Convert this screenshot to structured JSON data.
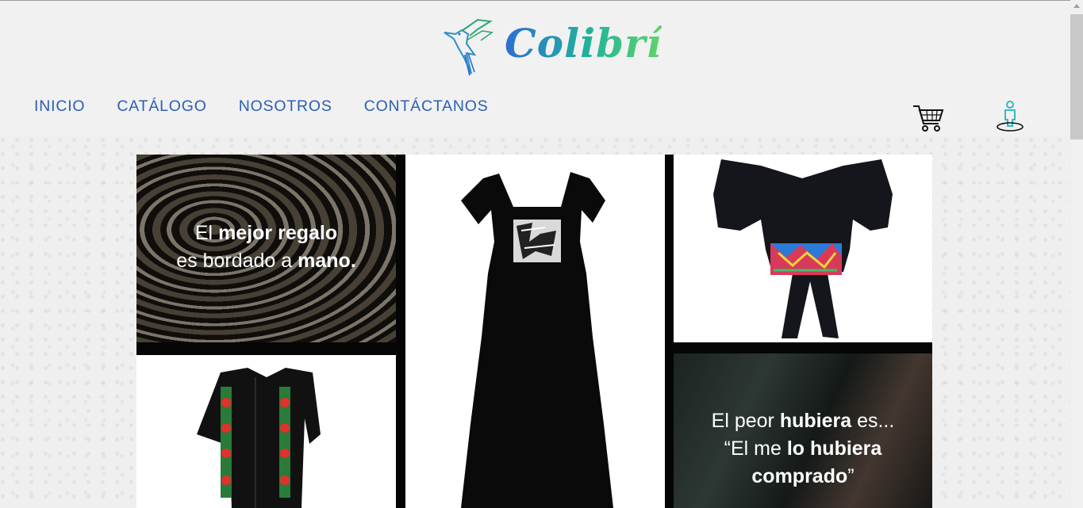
{
  "brand": {
    "name": "Colibrí",
    "logo_icon": "hummingbird-icon",
    "colors": [
      "#2a6fd1",
      "#22b39a",
      "#5fd36b"
    ]
  },
  "nav": {
    "items": [
      "INICIO",
      "CATÁLOGO",
      "NOSOTROS",
      "CONTÁCTANOS"
    ],
    "color": "#2a5fb5"
  },
  "header_icons": {
    "cart": "cart-icon",
    "user": "user-icon"
  },
  "tiles": {
    "embroidery": {
      "line1_plain": "El ",
      "line1_bold": "mejor regalo",
      "line2_plain": "es bordado a ",
      "line2_bold": "mano."
    },
    "dress": {
      "image": "black-embroidered-dress"
    },
    "blouse": {
      "image": "black-off-shoulder-blouse"
    },
    "shirt": {
      "image": "black-guayabera-rose-embroidery"
    },
    "quote": {
      "line1_plain": "El peor ",
      "line1_bold": "hubiera",
      "line1_plain2": " es...",
      "line2_plain": "“El me ",
      "line2_bold": "lo hubiera",
      "line3_bold": "comprado",
      "line3_plain": "”"
    }
  }
}
